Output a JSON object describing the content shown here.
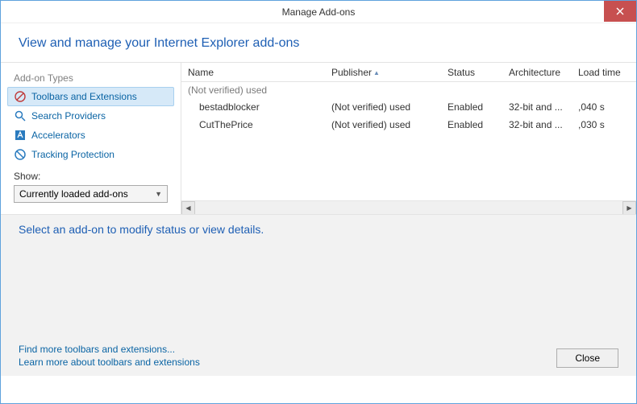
{
  "window": {
    "title": "Manage Add-ons"
  },
  "header": {
    "text": "View and manage your Internet Explorer add-ons"
  },
  "sidebar": {
    "types_label": "Add-on Types",
    "items": [
      {
        "label": "Toolbars and Extensions"
      },
      {
        "label": "Search Providers"
      },
      {
        "label": "Accelerators"
      },
      {
        "label": "Tracking Protection"
      }
    ],
    "show_label": "Show:",
    "dropdown_value": "Currently loaded add-ons"
  },
  "table": {
    "columns": {
      "name": "Name",
      "publisher": "Publisher",
      "status": "Status",
      "arch": "Architecture",
      "load": "Load time"
    },
    "group": "(Not verified) used",
    "rows": [
      {
        "name": "bestadblocker",
        "publisher": "(Not verified) used",
        "status": "Enabled",
        "arch": "32-bit and ...",
        "load": ",040 s"
      },
      {
        "name": "CutThePrice",
        "publisher": "(Not verified) used",
        "status": "Enabled",
        "arch": "32-bit and ...",
        "load": ",030 s"
      }
    ]
  },
  "details": {
    "prompt": "Select an add-on to modify status or view details."
  },
  "footer": {
    "link1": "Find more toolbars and extensions...",
    "link2": "Learn more about toolbars and extensions",
    "close": "Close"
  }
}
